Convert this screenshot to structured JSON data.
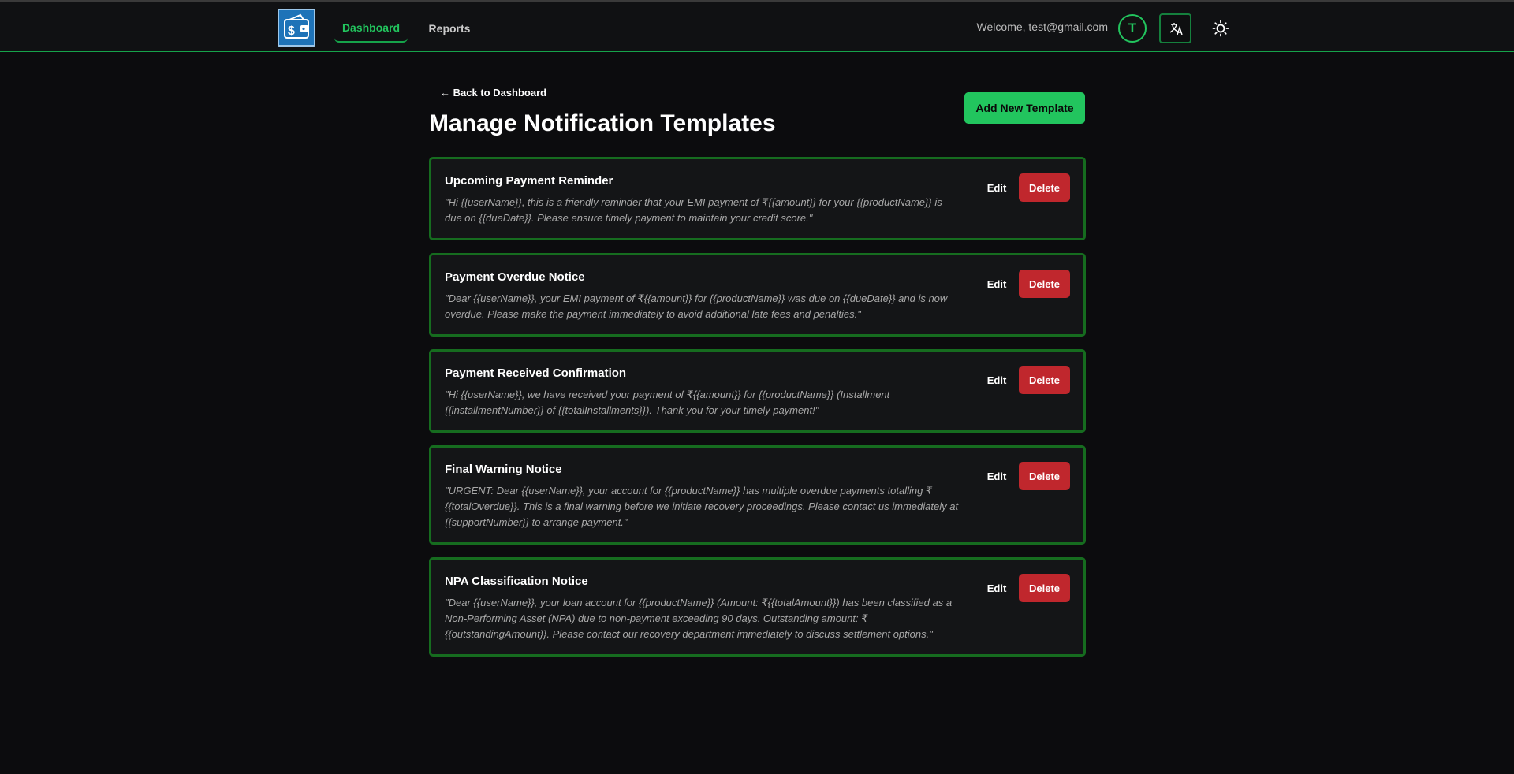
{
  "header": {
    "logo_icon": "wallet-dollar-icon",
    "nav": [
      {
        "label": "Dashboard",
        "active": true
      },
      {
        "label": "Reports",
        "active": false
      }
    ],
    "welcome_text": "Welcome, test@gmail.com",
    "avatar_initial": "T",
    "language_icon": "language-icon",
    "theme_icon": "sun-icon"
  },
  "page": {
    "back_link": "← Back to Dashboard",
    "title": "Manage Notification Templates",
    "add_button": "Add New Template"
  },
  "templates": [
    {
      "title": "Upcoming Payment Reminder",
      "body": "\"Hi {{userName}}, this is a friendly reminder that your EMI payment of ₹{{amount}} for your {{productName}} is due on {{dueDate}}. Please ensure timely payment to maintain your credit score.\"",
      "edit_label": "Edit",
      "delete_label": "Delete"
    },
    {
      "title": "Payment Overdue Notice",
      "body": "\"Dear {{userName}}, your EMI payment of ₹{{amount}} for {{productName}} was due on {{dueDate}} and is now overdue. Please make the payment immediately to avoid additional late fees and penalties.\"",
      "edit_label": "Edit",
      "delete_label": "Delete"
    },
    {
      "title": "Payment Received Confirmation",
      "body": "\"Hi {{userName}}, we have received your payment of ₹{{amount}} for {{productName}} (Installment {{installmentNumber}} of {{totalInstallments}}). Thank you for your timely payment!\"",
      "edit_label": "Edit",
      "delete_label": "Delete"
    },
    {
      "title": "Final Warning Notice",
      "body": "\"URGENT: Dear {{userName}}, your account for {{productName}} has multiple overdue payments totalling ₹{{totalOverdue}}. This is a final warning before we initiate recovery proceedings. Please contact us immediately at {{supportNumber}} to arrange payment.\"",
      "edit_label": "Edit",
      "delete_label": "Delete"
    },
    {
      "title": "NPA Classification Notice",
      "body": "\"Dear {{userName}}, your loan account for {{productName}} (Amount: ₹{{totalAmount}}) has been classified as a Non-Performing Asset (NPA) due to non-payment exceeding 90 days. Outstanding amount: ₹{{outstandingAmount}}. Please contact our recovery department immediately to discuss settlement options.\"",
      "edit_label": "Edit",
      "delete_label": "Delete"
    }
  ],
  "colors": {
    "accent": "#22c55e",
    "card_border": "#166c1f",
    "danger": "#c0272d",
    "background": "#0c0c0e"
  }
}
